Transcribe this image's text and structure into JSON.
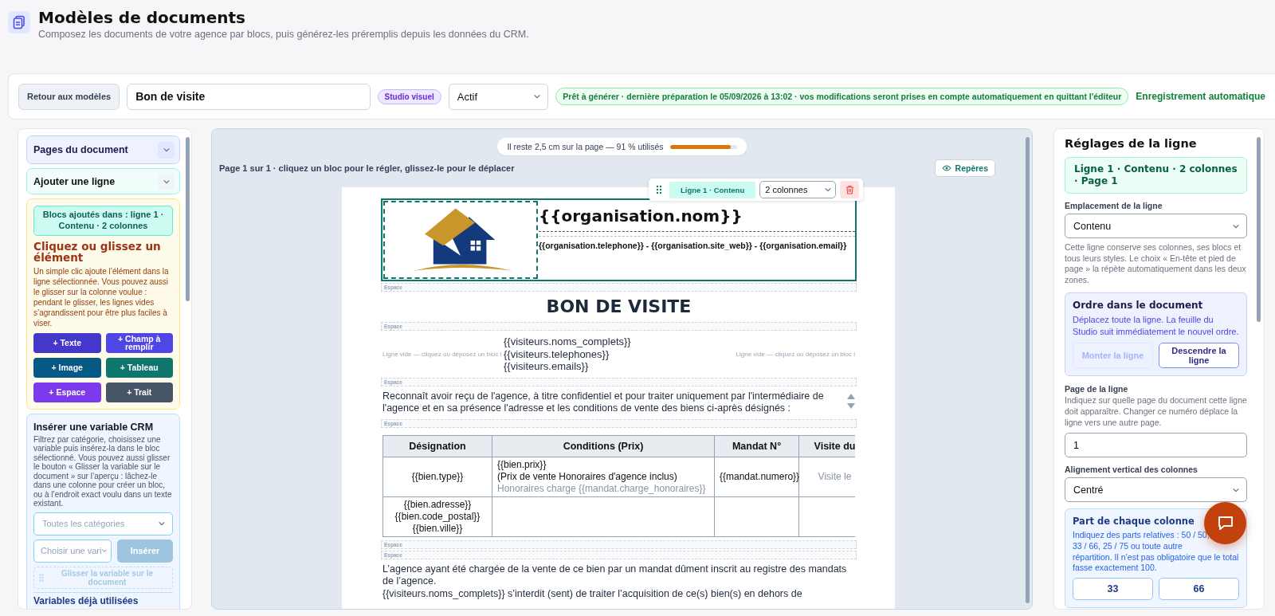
{
  "header": {
    "title": "Modèles de documents",
    "subtitle": "Composez les documents de votre agence par blocs, puis générez-les préremplis depuis les données du CRM."
  },
  "toolbar": {
    "back_button": "Retour aux modèles",
    "document_name": "Bon de visite",
    "mode_badge": "Studio visuel",
    "status": "Actif",
    "ready_message": "Prêt à générer · dernière préparation le 05/09/2026 à 13:02 · vos modifications seront prises en compte automatiquement en quittant l'éditeur",
    "autosave": "Enregistrement automatique"
  },
  "left_panel": {
    "sections": [
      {
        "title": "Pages du document",
        "expanded": false
      },
      {
        "title": "Ajouter une ligne",
        "expanded": false
      }
    ],
    "add_card": {
      "target": "Blocs ajoutés dans : ligne 1 · Contenu · 2 colonnes",
      "title": "Cliquez ou glissez un élément",
      "help": "Un simple clic ajoute l’élément dans la ligne sélectionnée. Vous pouvez aussi le glisser sur la colonne voulue : pendant le glisser, les lignes vides s’agrandissent pour être plus faciles à viser.",
      "buttons": [
        {
          "label": "+ Texte",
          "color": "#4338ca"
        },
        {
          "label": "+ Champ à remplir",
          "color": "#4f46e5"
        },
        {
          "label": "+ Image",
          "color": "#075985"
        },
        {
          "label": "+ Tableau",
          "color": "#0f766e"
        },
        {
          "label": "+ Espace",
          "color": "#7c3aed"
        },
        {
          "label": "+ Trait",
          "color": "#475569"
        }
      ]
    },
    "crm_card": {
      "title": "Insérer une variable CRM",
      "help": "Filtrez par catégorie, choisissez une variable puis insérez-la dans le bloc sélectionné. Vous pouvez aussi glisser le bouton « Glisser la variable sur le document » sur l’aperçu : lâchez-le dans une colonne pour créer un bloc, ou à l’endroit exact voulu dans un texte existant.",
      "category_placeholder": "Toutes les catégories",
      "variable_placeholder": "Choisir une vari",
      "insert_button": {
        "label": "Insérer",
        "disabled": true
      },
      "drag_button": {
        "label": "Glisser la variable sur le document",
        "disabled": true
      },
      "used_title": "Variables déjà utilisées"
    }
  },
  "canvas": {
    "usage": {
      "text": "Il reste 2,5 cm sur la page — 91 % utilisés",
      "level": 0.91
    },
    "hint": "Page 1 sur 1 · cliquez un bloc pour le régler, glissez-le pour le déplacer",
    "guides_button": "Repères",
    "row_toolbar": {
      "label": "Ligne 1 · Contenu",
      "columns": "2 colonnes"
    },
    "blocks": [
      {
        "kind": "header_row",
        "selected": true,
        "logo_selected": true,
        "name": "{{organisation.nom}}",
        "contact": "{{organisation.telephone}} - {{organisation.site_web}} - {{organisation.email}}"
      },
      {
        "kind": "spacer",
        "label": "Espace",
        "selected": false
      },
      {
        "kind": "title",
        "text": "BON DE VISITE",
        "selected": false
      },
      {
        "kind": "spacer",
        "label": "Espace",
        "selected": false
      },
      {
        "kind": "empty_row",
        "hint_left": "Ligne vide — cliquez ou déposez un bloc i",
        "lines": [
          "{{visiteurs.noms_complets}}",
          "{{visiteurs.telephones}}",
          "{{visiteurs.emails}}"
        ],
        "hint_right": "Ligne vide — cliquez ou déposez un bloc i",
        "selected": false
      },
      {
        "kind": "spacer",
        "label": "Espace",
        "selected": false
      },
      {
        "kind": "paragraph",
        "reorder_arrows": true,
        "lines": [
          "Reconnaît avoir reçu de l'agence, à titre confidentiel et pour traiter uniquement par l'intermédiaire de l'agence et en sa présence l'adresse et les conditions de vente des biens ci-après désignés  :"
        ],
        "selected": false
      },
      {
        "kind": "spacer",
        "label": "Espace",
        "selected": false
      },
      {
        "kind": "table",
        "selected": false,
        "columns": [
          "Désignation",
          "Conditions (Prix)",
          "Mandat N°",
          "Visite du"
        ],
        "rows": [
          [
            [
              {
                "text": "{{bien.type}}",
                "muted": false
              }
            ],
            [
              {
                "text": "{{bien.prix}}",
                "muted": false
              },
              {
                "text": "(Prix de vente Honoraires d'agence inclus)",
                "muted": false
              },
              {
                "text": "Honoraires charge {{mandat.charge_honoraires}}",
                "muted": true
              }
            ],
            [
              {
                "text": "{{mandat.numero}}",
                "muted": false
              }
            ],
            [
              {
                "text": "Visite le",
                "muted": true
              }
            ]
          ],
          [
            [
              {
                "text": "{{bien.adresse}}",
                "muted": false
              },
              {
                "text": "{{bien.code_postal}}",
                "muted": false
              },
              {
                "text": "{{bien.ville}}",
                "muted": false
              }
            ],
            null,
            null,
            null
          ]
        ]
      },
      {
        "kind": "spacer",
        "label": "Espace",
        "selected": false
      },
      {
        "kind": "spacer",
        "label": "Espace",
        "selected": false
      },
      {
        "kind": "paragraph",
        "reorder_arrows": false,
        "lines": [
          "L’agence ayant été chargée de la vente de ce bien par un mandat dûment inscrit au registre des mandats de l’agence.",
          "{{visiteurs.noms_complets}} s’interdit (sent) de traiter l’acquisition de ce(s) bien(s) en dehors de"
        ],
        "selected": false
      }
    ]
  },
  "settings": {
    "title": "Réglages de la ligne",
    "summary": "Ligne 1 · Contenu · 2 colonnes · Page 1",
    "placement": {
      "label": "Emplacement de la ligne",
      "value": "Contenu",
      "help": "Cette ligne conserve ses colonnes, ses blocs et tous leurs styles. Le choix « En-tête et pied de page » la répète automatiquement dans les deux zones."
    },
    "order": {
      "title": "Ordre dans le document",
      "text": "Déplacez toute la ligne. La feuille du Studio suit immédiatement le nouvel ordre.",
      "buttons": [
        {
          "label": "Monter la ligne",
          "disabled": true
        },
        {
          "label": "Descendre la ligne",
          "disabled": false
        }
      ]
    },
    "page": {
      "label": "Page de la ligne",
      "help": "Indiquez sur quelle page du document cette ligne doit apparaître. Changer ce numéro déplace la ligne vers une autre page.",
      "value": "1"
    },
    "alignment": {
      "label": "Alignement vertical des colonnes",
      "value": "Centré"
    },
    "widths": {
      "title": "Part de chaque colonne",
      "text": "Indiquez des parts relatives : 50 / 50, 33 / 66, 25 / 75 ou toute autre répartition. Il n’est pas obligatoire que le total fasse exactement 100.",
      "values": [
        "33",
        "66"
      ]
    }
  }
}
